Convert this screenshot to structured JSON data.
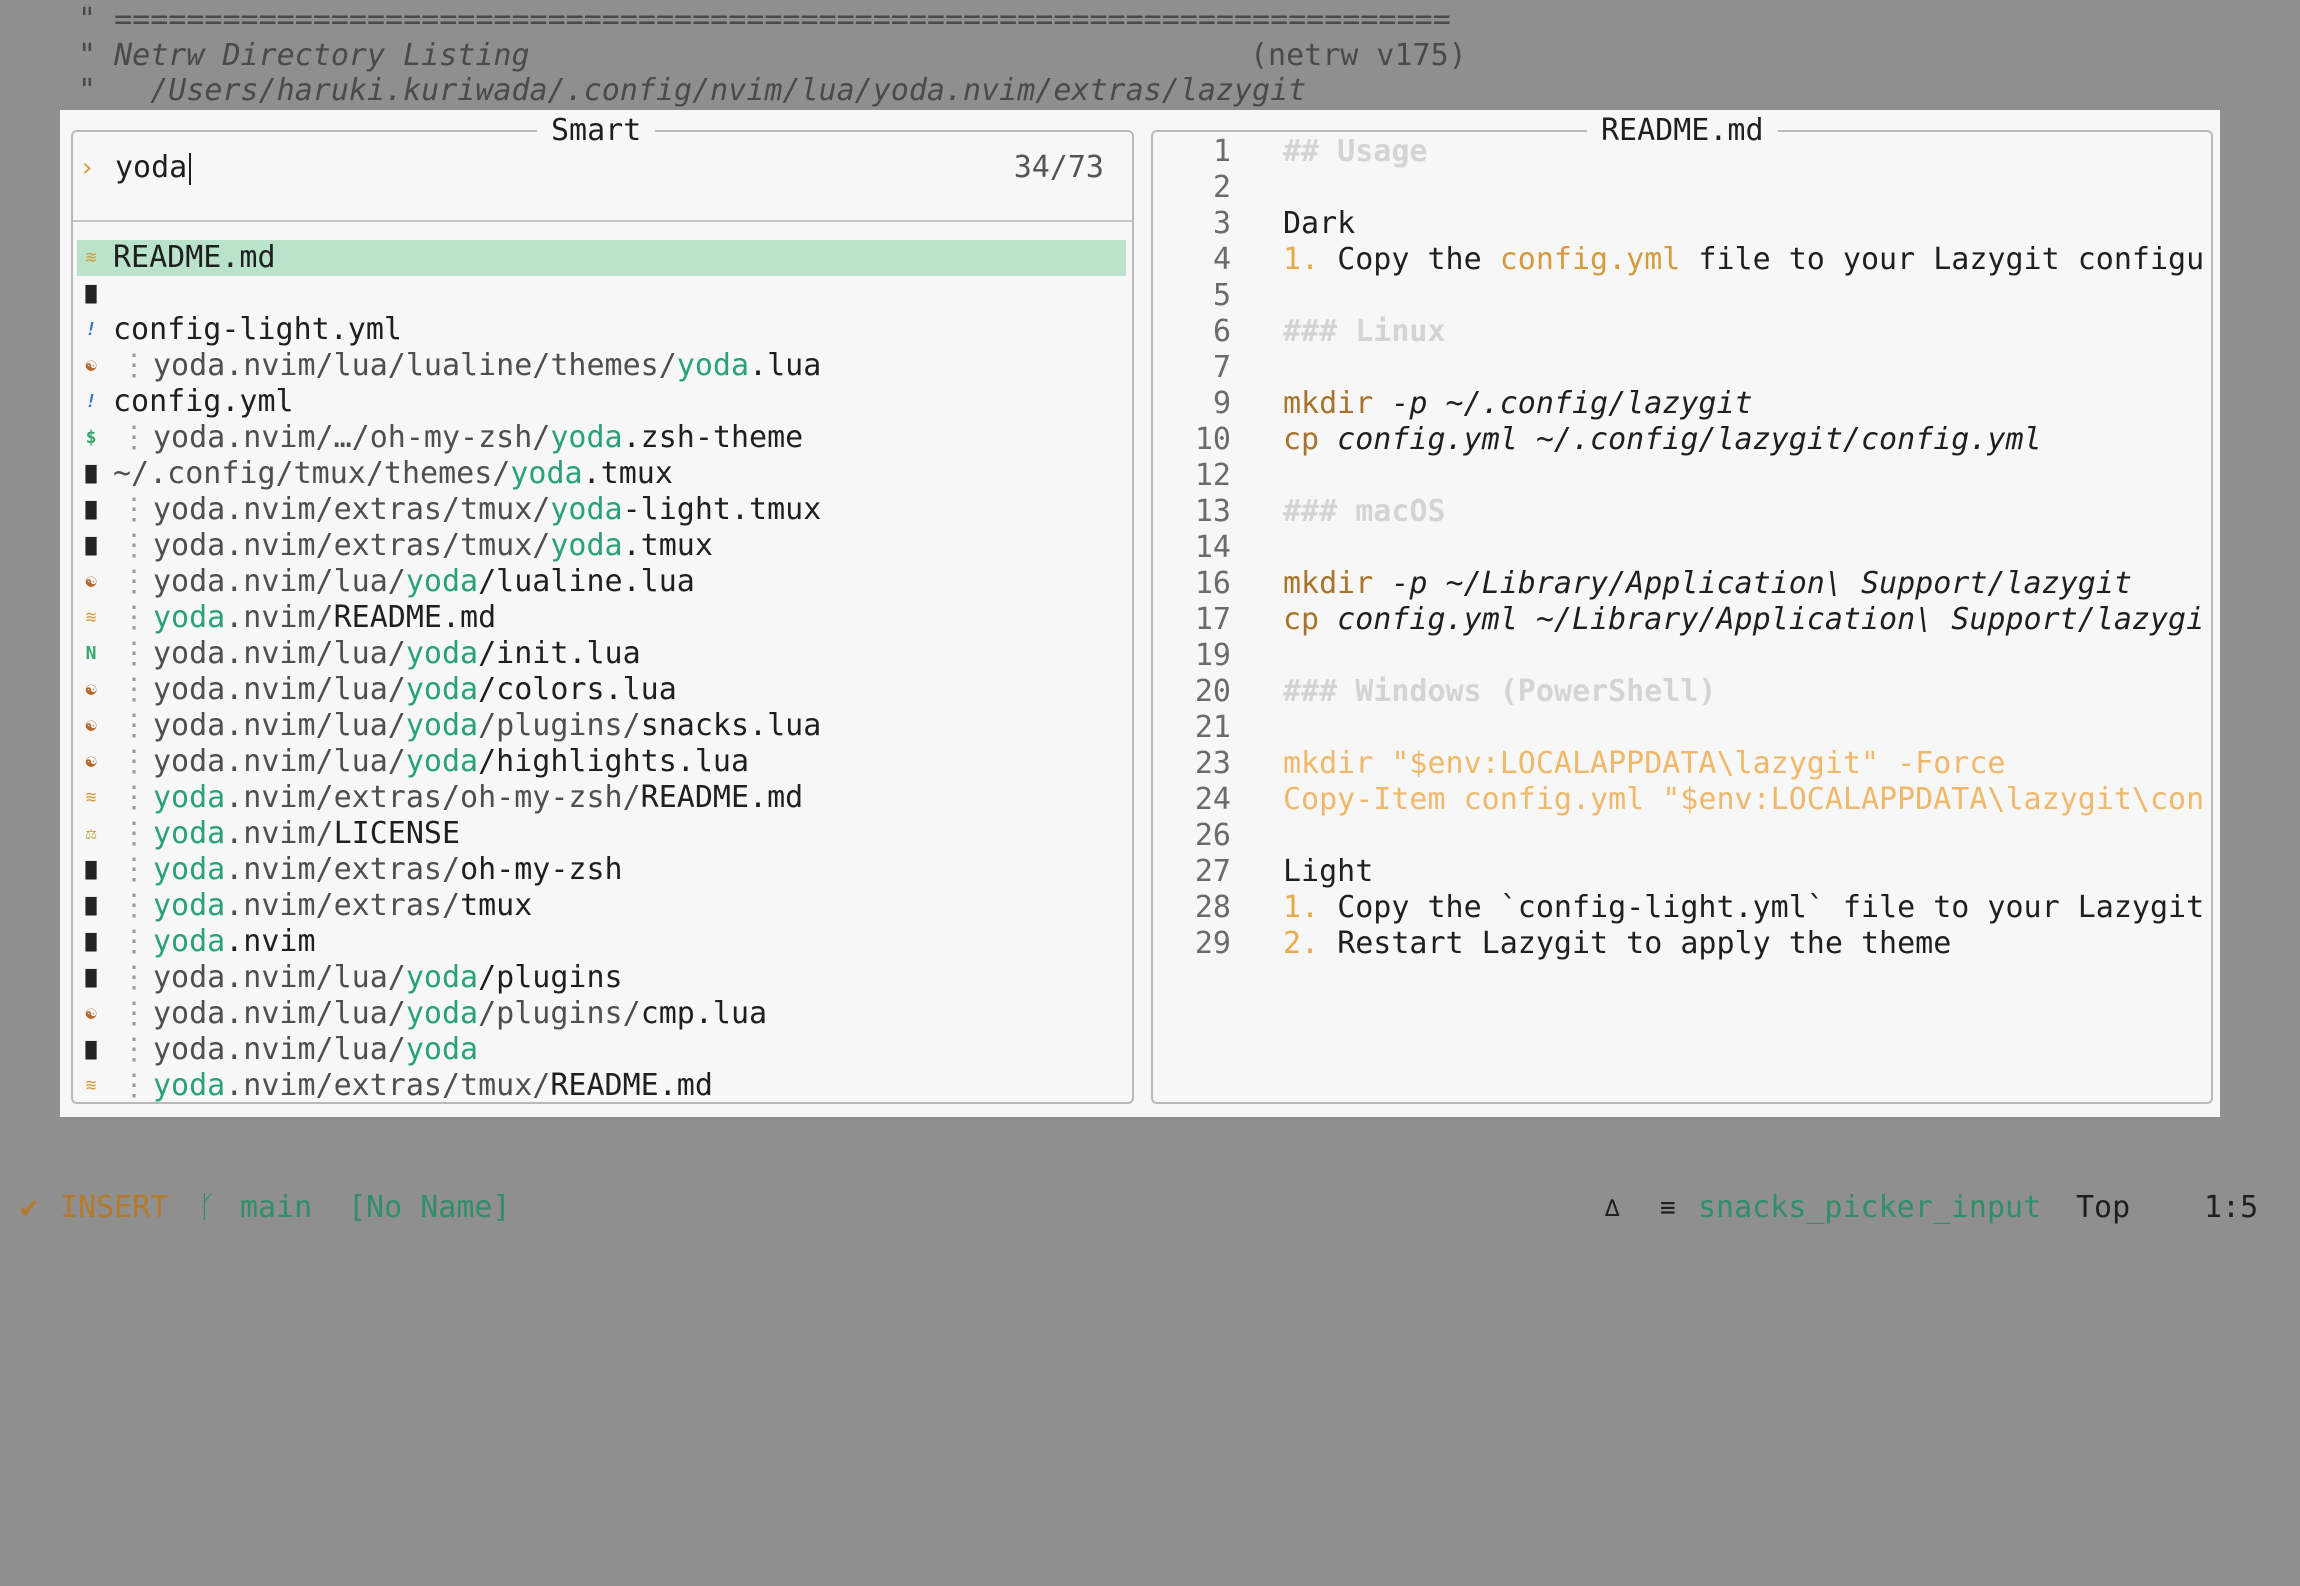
{
  "background": {
    "line1_prefix": "\"",
    "line1_rule": "==========================================================================",
    "line2_prefix": "\"",
    "line2_title": "Netrw Directory Listing",
    "line2_version": "(netrw v175)",
    "line3_prefix": "\"",
    "line3_path": "/Users/haruki.kuriwada/.config/nvim/lua/yoda.nvim/extras/lazygit"
  },
  "picker": {
    "title": "Smart",
    "prompt_icon": "chevron-right-icon",
    "query": "yoda",
    "count": "34/73",
    "items": [
      {
        "icon": "markdown-icon",
        "parts": [
          {
            "t": "README.md",
            "c": ""
          }
        ],
        "tree": false,
        "selected": true
      },
      {
        "icon": "file-icon",
        "parts": [],
        "tree": false,
        "selected": false
      },
      {
        "icon": "yaml-icon",
        "parts": [
          {
            "t": "config-light.yml",
            "c": ""
          }
        ],
        "tree": false,
        "selected": false
      },
      {
        "icon": "lua-icon",
        "parts": [
          {
            "t": "yoda.nvim/lua/lualine/themes/",
            "c": "dim"
          },
          {
            "t": "yoda",
            "c": "hl"
          },
          {
            "t": ".lua",
            "c": ""
          }
        ],
        "tree": true,
        "selected": false
      },
      {
        "icon": "yaml-icon",
        "parts": [
          {
            "t": "config.yml",
            "c": ""
          }
        ],
        "tree": false,
        "selected": false
      },
      {
        "icon": "shell-icon",
        "parts": [
          {
            "t": "yoda.nvim/…/oh-my-zsh/",
            "c": "dim"
          },
          {
            "t": "yoda",
            "c": "hl"
          },
          {
            "t": ".zsh-theme",
            "c": ""
          }
        ],
        "tree": true,
        "selected": false
      },
      {
        "icon": "file-icon",
        "parts": [
          {
            "t": "~/.config/tmux/themes/",
            "c": "dim"
          },
          {
            "t": "yoda",
            "c": "hl"
          },
          {
            "t": ".tmux",
            "c": ""
          }
        ],
        "tree": false,
        "selected": false
      },
      {
        "icon": "file-icon",
        "parts": [
          {
            "t": "yoda.nvim/extras/tmux/",
            "c": "dim"
          },
          {
            "t": "yoda",
            "c": "hl"
          },
          {
            "t": "-light.tmux",
            "c": ""
          }
        ],
        "tree": true,
        "selected": false
      },
      {
        "icon": "file-icon",
        "parts": [
          {
            "t": "yoda.nvim/extras/tmux/",
            "c": "dim"
          },
          {
            "t": "yoda",
            "c": "hl"
          },
          {
            "t": ".tmux",
            "c": ""
          }
        ],
        "tree": true,
        "selected": false
      },
      {
        "icon": "lua-icon",
        "parts": [
          {
            "t": "yoda.nvim/lua/",
            "c": "dim"
          },
          {
            "t": "yoda",
            "c": "hl"
          },
          {
            "t": "/lualine.lua",
            "c": ""
          }
        ],
        "tree": true,
        "selected": false
      },
      {
        "icon": "markdown-icon",
        "parts": [
          {
            "t": "yoda",
            "c": "hl"
          },
          {
            "t": ".nvim/",
            "c": "dim"
          },
          {
            "t": "README.md",
            "c": ""
          }
        ],
        "tree": true,
        "selected": false
      },
      {
        "icon": "neovim-icon",
        "parts": [
          {
            "t": "yoda.nvim/lua/",
            "c": "dim"
          },
          {
            "t": "yoda",
            "c": "hl"
          },
          {
            "t": "/init.lua",
            "c": ""
          }
        ],
        "tree": true,
        "selected": false
      },
      {
        "icon": "lua-icon",
        "parts": [
          {
            "t": "yoda.nvim/lua/",
            "c": "dim"
          },
          {
            "t": "yoda",
            "c": "hl"
          },
          {
            "t": "/colors.lua",
            "c": ""
          }
        ],
        "tree": true,
        "selected": false
      },
      {
        "icon": "lua-icon",
        "parts": [
          {
            "t": "yoda.nvim/lua/",
            "c": "dim"
          },
          {
            "t": "yoda",
            "c": "hl"
          },
          {
            "t": "/plugins/",
            "c": "dim"
          },
          {
            "t": "snacks.lua",
            "c": ""
          }
        ],
        "tree": true,
        "selected": false
      },
      {
        "icon": "lua-icon",
        "parts": [
          {
            "t": "yoda.nvim/lua/",
            "c": "dim"
          },
          {
            "t": "yoda",
            "c": "hl"
          },
          {
            "t": "/highlights.lua",
            "c": ""
          }
        ],
        "tree": true,
        "selected": false
      },
      {
        "icon": "markdown-icon",
        "parts": [
          {
            "t": "yoda",
            "c": "hl"
          },
          {
            "t": ".nvim/extras/oh-my-zsh/",
            "c": "dim"
          },
          {
            "t": "README.md",
            "c": ""
          }
        ],
        "tree": true,
        "selected": false
      },
      {
        "icon": "license-icon",
        "parts": [
          {
            "t": "yoda",
            "c": "hl"
          },
          {
            "t": ".nvim/",
            "c": "dim"
          },
          {
            "t": "LICENSE",
            "c": ""
          }
        ],
        "tree": true,
        "selected": false
      },
      {
        "icon": "file-icon",
        "parts": [
          {
            "t": "yoda",
            "c": "hl"
          },
          {
            "t": ".nvim/extras/",
            "c": "dim"
          },
          {
            "t": "oh-my-zsh",
            "c": ""
          }
        ],
        "tree": true,
        "selected": false
      },
      {
        "icon": "file-icon",
        "parts": [
          {
            "t": "yoda",
            "c": "hl"
          },
          {
            "t": ".nvim/extras/",
            "c": "dim"
          },
          {
            "t": "tmux",
            "c": ""
          }
        ],
        "tree": true,
        "selected": false
      },
      {
        "icon": "file-icon",
        "parts": [
          {
            "t": "yoda",
            "c": "hl"
          },
          {
            "t": ".nvim",
            "c": ""
          }
        ],
        "tree": true,
        "selected": false
      },
      {
        "icon": "file-icon",
        "parts": [
          {
            "t": "yoda.nvim/lua/",
            "c": "dim"
          },
          {
            "t": "yoda",
            "c": "hl"
          },
          {
            "t": "/plugins",
            "c": ""
          }
        ],
        "tree": true,
        "selected": false
      },
      {
        "icon": "lua-icon",
        "parts": [
          {
            "t": "yoda.nvim/lua/",
            "c": "dim"
          },
          {
            "t": "yoda",
            "c": "hl"
          },
          {
            "t": "/plugins/",
            "c": "dim"
          },
          {
            "t": "cmp.lua",
            "c": ""
          }
        ],
        "tree": true,
        "selected": false
      },
      {
        "icon": "file-icon",
        "parts": [
          {
            "t": "yoda.nvim/lua/",
            "c": "dim"
          },
          {
            "t": "yoda",
            "c": "hl"
          }
        ],
        "tree": true,
        "selected": false
      },
      {
        "icon": "markdown-icon",
        "parts": [
          {
            "t": "yoda",
            "c": "hl"
          },
          {
            "t": ".nvim/extras/tmux/",
            "c": "dim"
          },
          {
            "t": "README.md",
            "c": ""
          }
        ],
        "tree": true,
        "selected": false
      }
    ]
  },
  "preview": {
    "title": "README.md",
    "lines": [
      {
        "n": "1",
        "parts": [
          {
            "t": "## Usage",
            "c": "h"
          }
        ]
      },
      {
        "n": "2",
        "parts": []
      },
      {
        "n": "3",
        "parts": [
          {
            "t": "Dark",
            "c": ""
          }
        ]
      },
      {
        "n": "4",
        "parts": [
          {
            "t": "1. ",
            "c": "num"
          },
          {
            "t": "Copy the ",
            "c": ""
          },
          {
            "t": "config.yml",
            "c": "fn"
          },
          {
            "t": " file to your Lazygit configu",
            "c": ""
          }
        ]
      },
      {
        "n": "5",
        "parts": []
      },
      {
        "n": "6",
        "parts": [
          {
            "t": "### Linux",
            "c": "h"
          }
        ]
      },
      {
        "n": "7",
        "parts": []
      },
      {
        "n": "9",
        "parts": [
          {
            "t": "mkdir",
            "c": "kw"
          },
          {
            "t": " -p ~/.config/lazygit",
            "c": "it"
          }
        ]
      },
      {
        "n": "10",
        "parts": [
          {
            "t": "cp",
            "c": "kw"
          },
          {
            "t": " config.yml ~/.config/lazygit/config.yml",
            "c": "it"
          }
        ]
      },
      {
        "n": "12",
        "parts": []
      },
      {
        "n": "13",
        "parts": [
          {
            "t": "### macOS",
            "c": "h"
          }
        ]
      },
      {
        "n": "14",
        "parts": []
      },
      {
        "n": "16",
        "parts": [
          {
            "t": "mkdir",
            "c": "kw"
          },
          {
            "t": " -p ~/Library/Application\\ Support/lazygit",
            "c": "it"
          }
        ]
      },
      {
        "n": "17",
        "parts": [
          {
            "t": "cp",
            "c": "kw"
          },
          {
            "t": " config.yml ~/Library/Application\\ Support/lazygi",
            "c": "it"
          }
        ]
      },
      {
        "n": "19",
        "parts": []
      },
      {
        "n": "20",
        "parts": [
          {
            "t": "### Windows (PowerShell)",
            "c": "h"
          }
        ]
      },
      {
        "n": "21",
        "parts": []
      },
      {
        "n": "23",
        "parts": [
          {
            "t": "mkdir \"$env:LOCALAPPDATA\\lazygit\" -Force",
            "c": "str"
          }
        ]
      },
      {
        "n": "24",
        "parts": [
          {
            "t": "Copy-Item config.yml \"$env:LOCALAPPDATA\\lazygit\\con",
            "c": "str"
          }
        ]
      },
      {
        "n": "26",
        "parts": []
      },
      {
        "n": "27",
        "parts": [
          {
            "t": "Light",
            "c": ""
          }
        ]
      },
      {
        "n": "28",
        "parts": [
          {
            "t": "1. ",
            "c": "num"
          },
          {
            "t": "Copy the `config-light.yml` file to your Lazygit",
            "c": ""
          }
        ]
      },
      {
        "n": "29",
        "parts": [
          {
            "t": "2. ",
            "c": "num"
          },
          {
            "t": "Restart Lazygit to apply the theme",
            "c": ""
          }
        ]
      }
    ]
  },
  "statusline": {
    "mode_icon": "check-icon",
    "mode": "INSERT",
    "branch_icon": "git-branch-icon",
    "branch": "main",
    "buffer": "[No Name]",
    "diag_icon": "delta-icon",
    "filetype_icon": "list-icon",
    "filetype": "snacks_picker_input",
    "position": "Top",
    "cursor": "1:5",
    "colors": {
      "mode": "#b5792e",
      "branch": "#2f8f6a",
      "buffer": "#2f8f6a",
      "filetype": "#2f8f6a"
    }
  }
}
